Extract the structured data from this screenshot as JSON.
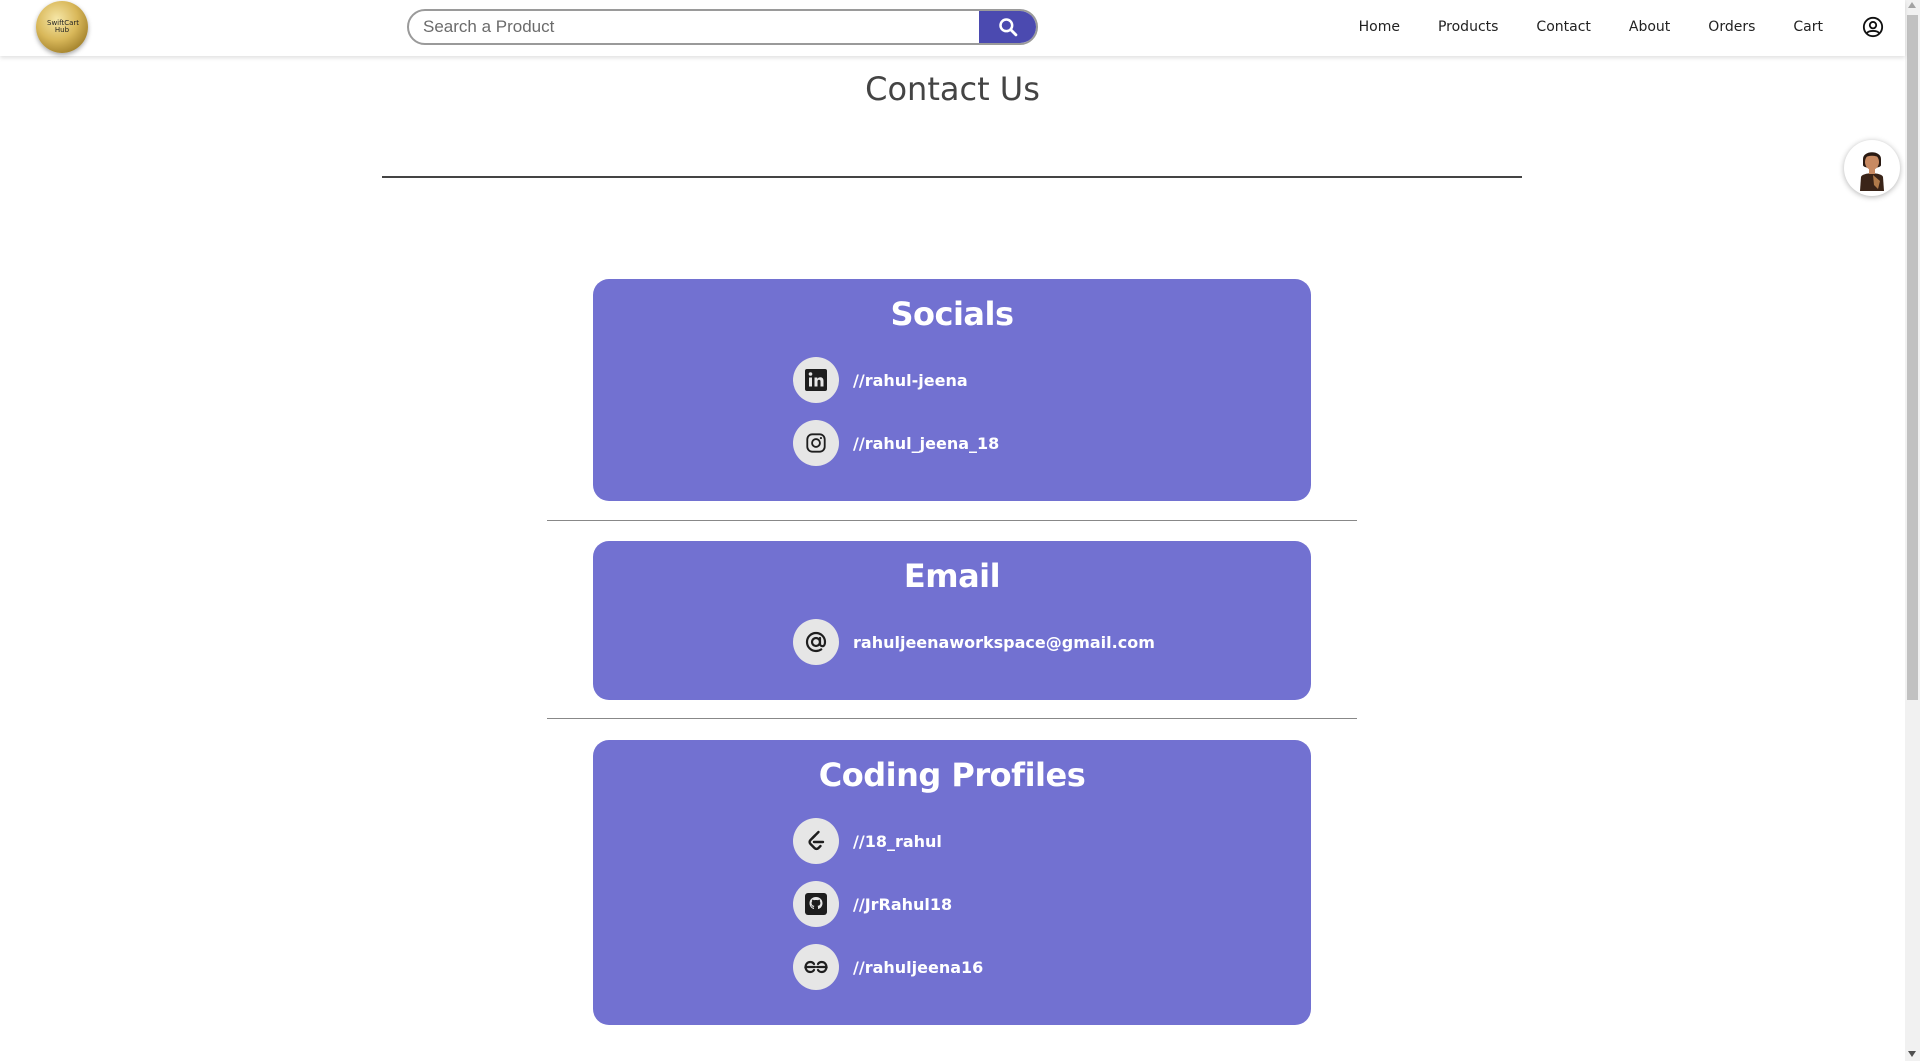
{
  "navbar": {
    "logo_text": "SwiftCart Hub",
    "search_placeholder": "Search a Product",
    "links": [
      "Home",
      "Products",
      "Contact",
      "About",
      "Orders",
      "Cart"
    ],
    "accent_color": "#4b4ab0"
  },
  "page": {
    "title": "Contact Us"
  },
  "sections": {
    "socials": {
      "title": "Socials",
      "items": [
        {
          "icon": "linkedin-icon",
          "text": "//rahul-jeena"
        },
        {
          "icon": "instagram-icon",
          "text": "//rahul_jeena_18"
        }
      ]
    },
    "email": {
      "title": "Email",
      "items": [
        {
          "icon": "at-sign-icon",
          "text": "rahuljeenaworkspace@gmail.com"
        }
      ]
    },
    "coding": {
      "title": "Coding Profiles",
      "items": [
        {
          "icon": "leetcode-icon",
          "text": "//18_rahul"
        },
        {
          "icon": "github-icon",
          "text": "//JrRahul18"
        },
        {
          "icon": "geeksforgeeks-icon",
          "text": "//rahuljeena16"
        }
      ]
    }
  },
  "colors": {
    "card_background": "#7271d1",
    "icon_circle": "#e6e6e6"
  }
}
